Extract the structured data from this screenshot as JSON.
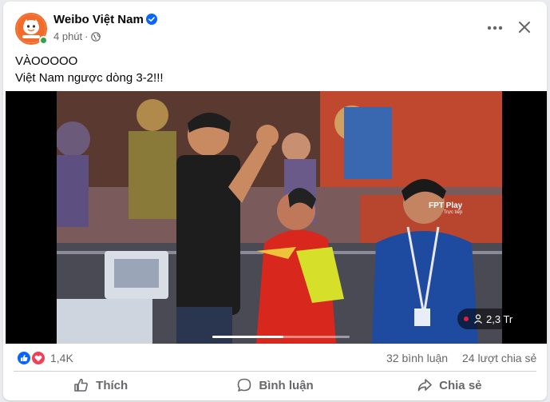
{
  "post": {
    "page_name": "Weibo Việt Nam",
    "timestamp": "4 phút",
    "audience_icon": "globe-icon",
    "text_lines": [
      "VÀOOOOO",
      "Việt Nam ngược dòng 3-2!!!"
    ],
    "verified_icon": "verified-badge-icon",
    "avatar_text": "WEIBO VIETNAM"
  },
  "video": {
    "logo_text": "FPT Play",
    "logo_sub": "Trực tiếp",
    "viewer_count": "2,3 Tr",
    "progress_fraction": 0.52
  },
  "stats": {
    "reactions_count": "1,4K",
    "comments_count": "32 bình luận",
    "shares_count": "24 lượt chia sẻ",
    "reaction_icons": [
      "like-icon",
      "love-icon"
    ]
  },
  "actions": {
    "like_label": "Thích",
    "comment_label": "Bình luận",
    "share_label": "Chia sẻ"
  },
  "colors": {
    "verified_blue": "#0866ff",
    "brand_orange": "#f26b2a",
    "love_red": "#f33e58",
    "online_green": "#31a24c"
  }
}
